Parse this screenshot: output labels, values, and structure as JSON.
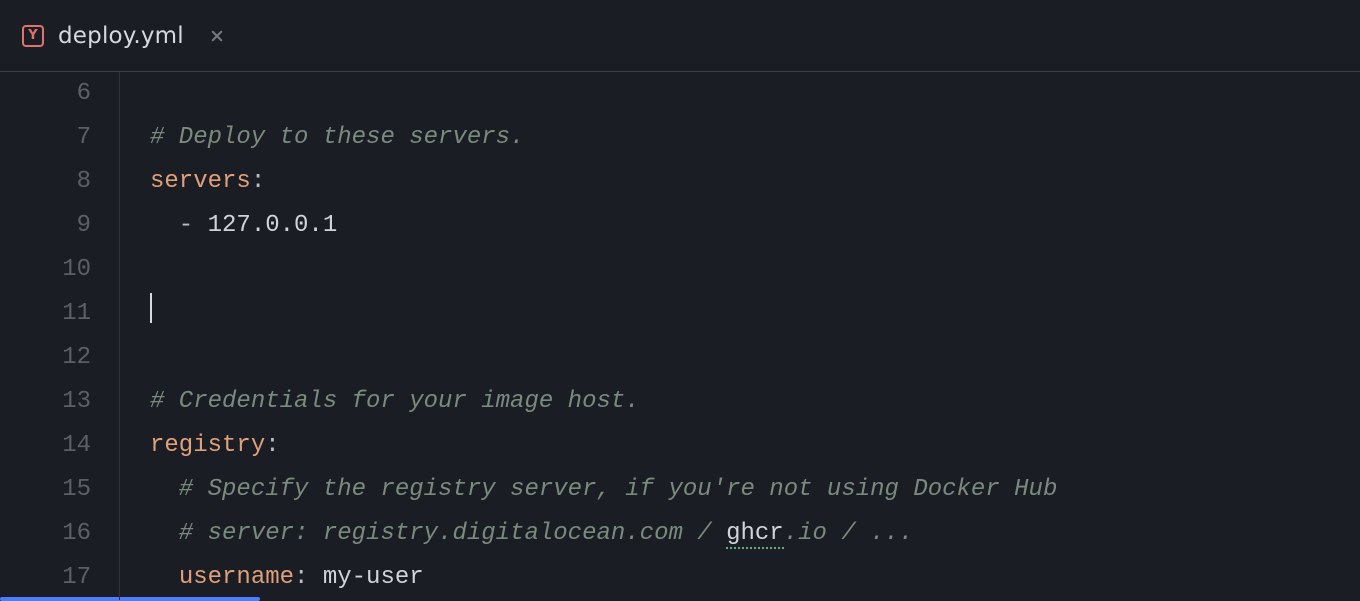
{
  "tab": {
    "filename": "deploy.yml",
    "icon_letter": "Y"
  },
  "editor": {
    "first_line_number": 6,
    "active_line_index": 5,
    "lines": [
      {
        "tokens": []
      },
      {
        "tokens": [
          {
            "cls": "c",
            "text": "# Deploy to these servers."
          }
        ]
      },
      {
        "tokens": [
          {
            "cls": "k",
            "text": "servers"
          },
          {
            "cls": "p",
            "text": ":"
          }
        ]
      },
      {
        "tokens": [
          {
            "cls": "p",
            "text": "  - "
          },
          {
            "cls": "s",
            "text": "127.0.0.1"
          }
        ]
      },
      {
        "tokens": []
      },
      {
        "tokens": [],
        "cursor": true
      },
      {
        "tokens": []
      },
      {
        "tokens": [
          {
            "cls": "c",
            "text": "# Credentials for your image host."
          }
        ]
      },
      {
        "tokens": [
          {
            "cls": "k",
            "text": "registry"
          },
          {
            "cls": "p",
            "text": ":"
          }
        ]
      },
      {
        "tokens": [
          {
            "cls": "c",
            "text": "  # Specify the registry server, if you're not using Docker Hub"
          }
        ]
      },
      {
        "tokens": [
          {
            "cls": "c",
            "text": "  # server: registry.digitalocean.com / "
          },
          {
            "cls": "sq",
            "text": "ghcr"
          },
          {
            "cls": "c",
            "text": ".io / ..."
          }
        ]
      },
      {
        "tokens": [
          {
            "cls": "p",
            "text": "  "
          },
          {
            "cls": "k",
            "text": "username"
          },
          {
            "cls": "p",
            "text": ": "
          },
          {
            "cls": "s",
            "text": "my-user"
          }
        ]
      }
    ]
  }
}
